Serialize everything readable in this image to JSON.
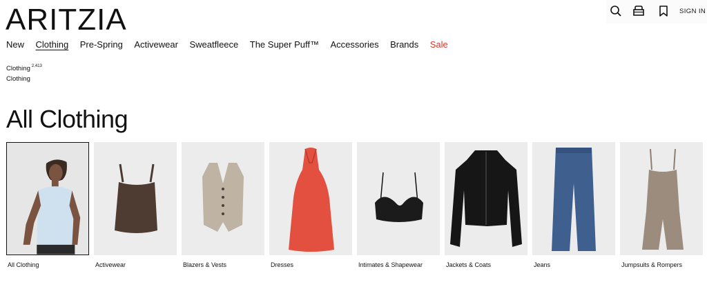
{
  "brand": {
    "logo_text": "ARITZIA"
  },
  "utility": {
    "icons": [
      "search-icon",
      "bag-icon",
      "bookmark-icon"
    ],
    "sign_in_label": "SIGN IN"
  },
  "nav": {
    "items": [
      {
        "label": "New"
      },
      {
        "label": "Clothing",
        "active": true
      },
      {
        "label": "Pre-Spring"
      },
      {
        "label": "Activewear"
      },
      {
        "label": "Sweatfleece"
      },
      {
        "label": "The Super Puff™"
      },
      {
        "label": "Accessories"
      },
      {
        "label": "Brands"
      },
      {
        "label": "Sale",
        "color": "#d33a2c"
      }
    ]
  },
  "breadcrumb": {
    "category": "Clothing",
    "count": "2,413",
    "current": "Clothing"
  },
  "page_title": "All Clothing",
  "categories": [
    {
      "label": "All Clothing",
      "image": "model-white-top",
      "selected": true
    },
    {
      "label": "Activewear",
      "image": "brown-tank"
    },
    {
      "label": "Blazers & Vests",
      "image": "beige-vest"
    },
    {
      "label": "Dresses",
      "image": "red-halter-dress"
    },
    {
      "label": "Intimates & Shapewear",
      "image": "black-lace-bralette"
    },
    {
      "label": "Jackets & Coats",
      "image": "black-leather-jacket"
    },
    {
      "label": "Jeans",
      "image": "blue-jeans"
    },
    {
      "label": "Jumpsuits & Rompers",
      "image": "taupe-romper"
    }
  ]
}
